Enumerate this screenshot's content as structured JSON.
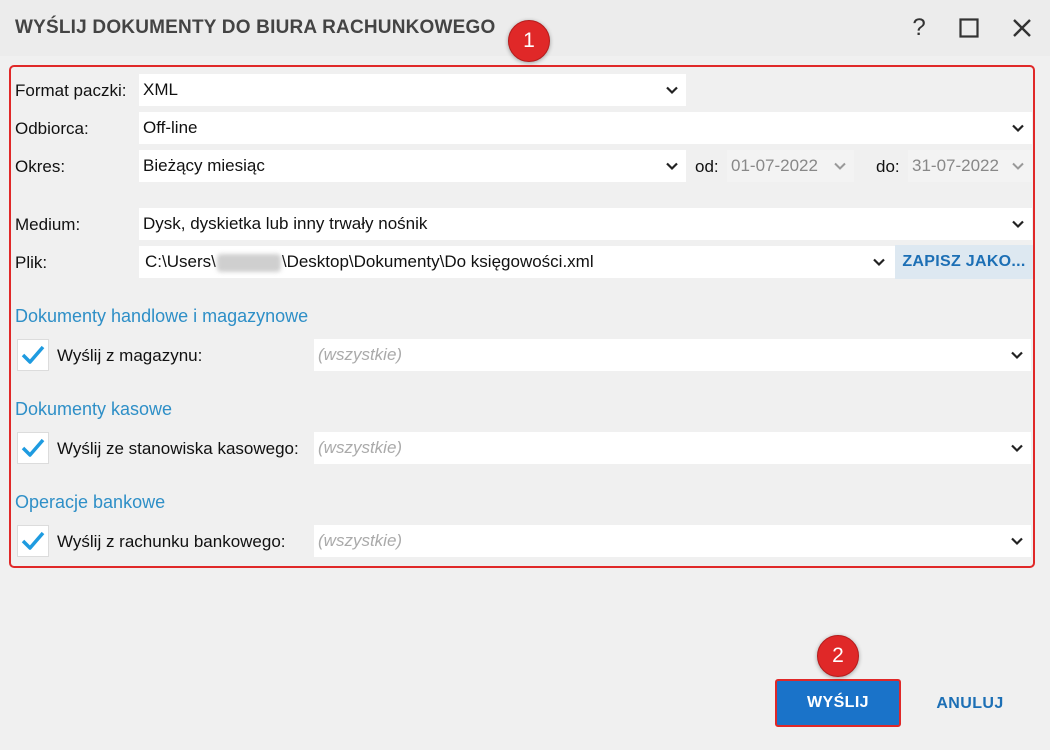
{
  "dialog": {
    "title": "WYŚLIJ DOKUMENTY DO BIURA RACHUNKOWEGO",
    "help_glyph": "?"
  },
  "markers": [
    "1",
    "2"
  ],
  "form": {
    "format": {
      "label": "Format paczki:",
      "value": "XML"
    },
    "recipient": {
      "label": "Odbiorca:",
      "value": "Off-line"
    },
    "period": {
      "label": "Okres:",
      "value": "Bieżący miesiąc",
      "from_label": "od:",
      "from_value": "01-07-2022",
      "to_label": "do:",
      "to_value": "31-07-2022"
    },
    "medium": {
      "label": "Medium:",
      "value": "Dysk, dyskietka lub inny trwały nośnik"
    },
    "file": {
      "label": "Plik:",
      "path_prefix": "C:\\Users\\",
      "path_suffix": "\\Desktop\\Dokumenty\\Do księgowości.xml",
      "save_as": "ZAPISZ JAKO..."
    }
  },
  "sections": {
    "trade": {
      "title": "Dokumenty handlowe i magazynowe",
      "label": "Wyślij z magazynu:",
      "placeholder": "(wszystkie)",
      "checked": true
    },
    "cash": {
      "title": "Dokumenty kasowe",
      "label": "Wyślij ze stanowiska kasowego:",
      "placeholder": "(wszystkie)",
      "checked": true
    },
    "bank": {
      "title": "Operacje bankowe",
      "label": "Wyślij z rachunku bankowego:",
      "placeholder": "(wszystkie)",
      "checked": true
    }
  },
  "buttons": {
    "send": "WYŚLIJ",
    "cancel": "ANULUJ"
  },
  "colors": {
    "accent": "#1a73c9",
    "section": "#2e8fc7",
    "marker": "#e02828",
    "check": "#1e9be0"
  }
}
